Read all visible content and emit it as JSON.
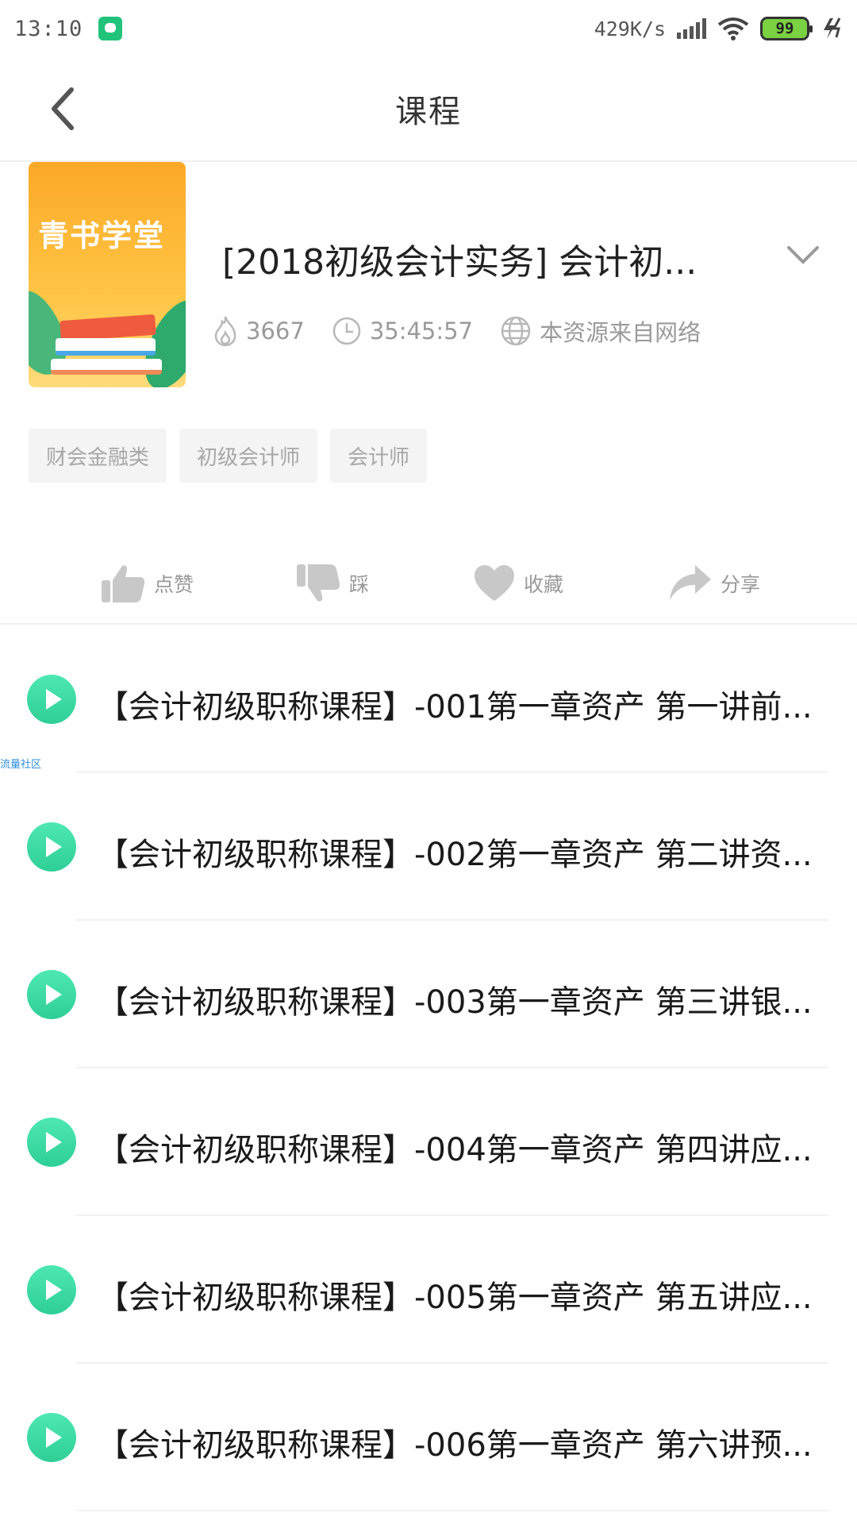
{
  "status_bar": {
    "time": "13:10",
    "net_speed": "429K/s",
    "battery": "99",
    "icons": [
      "app-notification-icon",
      "signal-icon",
      "wifi-icon",
      "battery-icon",
      "charging-icon"
    ]
  },
  "nav": {
    "title": "课程",
    "back_icon": "back-chevron-icon"
  },
  "course": {
    "cover_text": "青书学堂",
    "title": "[2018初级会计实务] 会计初...",
    "views": "3667",
    "duration": "35:45:57",
    "source": "本资源来自网络"
  },
  "tags": [
    "财会金融类",
    "初级会计师",
    "会计师"
  ],
  "actions": {
    "like": "点赞",
    "dislike": "踩",
    "favorite": "收藏",
    "share": "分享"
  },
  "lessons": [
    "【会计初级职称课程】-001第一章资产 第一讲前...",
    "【会计初级职称课程】-002第一章资产 第二讲资...",
    "【会计初级职称课程】-003第一章资产 第三讲银...",
    "【会计初级职称课程】-004第一章资产 第四讲应...",
    "【会计初级职称课程】-005第一章资产 第五讲应...",
    "【会计初级职称课程】-006第一章资产 第六讲预..."
  ],
  "watermark": "流量社区",
  "colors": {
    "accent_green": "#2ecf96",
    "muted_text": "#9a9a9a",
    "tag_bg": "#f4f4f4"
  }
}
